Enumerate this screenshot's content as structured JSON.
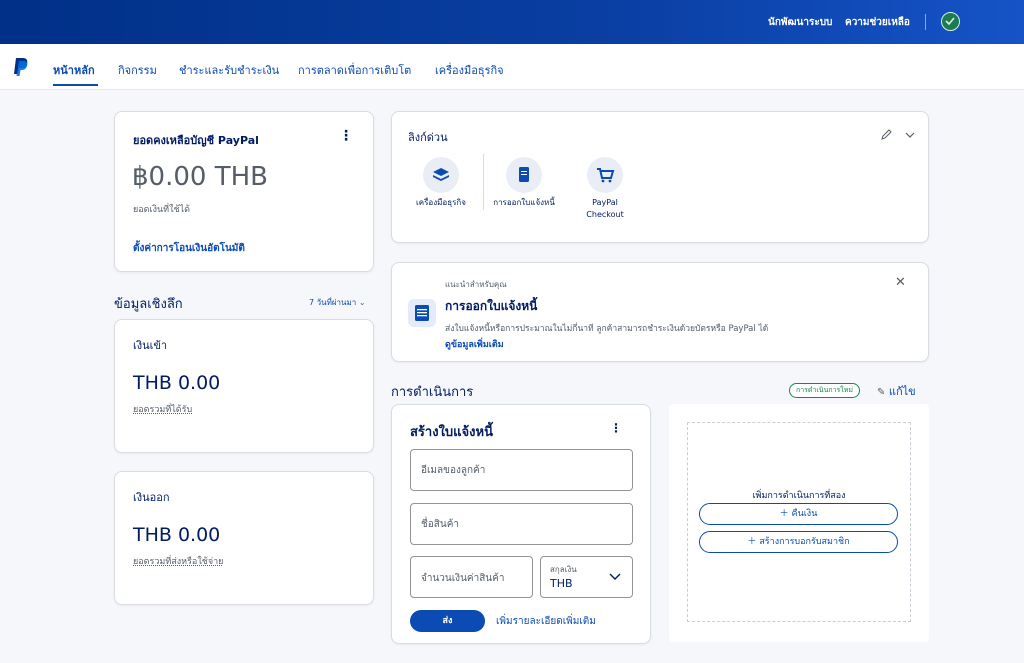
{
  "topbar": {
    "developer": "นักพัฒนาระบบ",
    "help": "ความช่วยเหลือ",
    "avatar_color": "#1e7a52"
  },
  "nav": {
    "tabs": [
      {
        "label": "หน้าหลัก",
        "active": true
      },
      {
        "label": "กิจกรรม"
      },
      {
        "label": "ชำระและรับชำระเงิน"
      },
      {
        "label": "การตลาดเพื่อการเติบโต"
      },
      {
        "label": "เครื่องมือธุรกิจ"
      }
    ]
  },
  "balance": {
    "title": "ยอดคงเหลือบัญชี PayPal",
    "amount": "฿0.00 THB",
    "subtitle": "ยอดเงินที่ใช้ได้",
    "auto_transfer": "ตั้งค่าการโอนเงินอัตโนมัติ"
  },
  "insights": {
    "title": "ข้อมูลเชิงลึก",
    "period": "7 วันที่ผ่านมา",
    "money_in": {
      "title": "เงินเข้า",
      "amount": "THB 0.00",
      "caption": "ยอดรวมที่ได้รับ"
    },
    "money_out": {
      "title": "เงินออก",
      "amount": "THB 0.00",
      "caption": "ยอดรวมที่ส่งหรือใช้จ่าย"
    }
  },
  "quick_links": {
    "title": "ลิงก์ด่วน",
    "items": [
      {
        "label": "เครื่องมือธุรกิจ",
        "icon": "layers-icon"
      },
      {
        "label": "การออกใบแจ้งหนี้",
        "icon": "document-icon"
      },
      {
        "label": "PayPal Checkout",
        "icon": "cart-icon"
      }
    ]
  },
  "recommend": {
    "eyebrow": "แนะนำสำหรับคุณ",
    "title": "การออกใบแจ้งหนี้",
    "body": "ส่งใบแจ้งหนี้หรือการประมาณในไม่กี่นาที ลูกค้าสามารถชำระเงินด้วยบัตรหรือ PayPal ได้",
    "link": "ดูข้อมูลเพิ่มเติม"
  },
  "actions": {
    "title": "การดำเนินการ",
    "new_badge": "การดำเนินการใหม่",
    "edit": "แก้ไข"
  },
  "invoice": {
    "title": "สร้างใบแจ้งหนี้",
    "email_placeholder": "อีเมลของลูกค้า",
    "product_placeholder": "ชื่อสินค้า",
    "amount_placeholder": "จำนวนเงินค่าสินค้า",
    "currency_label": "สกุลเงิน",
    "currency_value": "THB",
    "send": "ส่ง",
    "more_details": "เพิ่มรายละเอียดเพิ่มเติม"
  },
  "second_action": {
    "title": "เพิ่มการดำเนินการที่สอง",
    "refund": "คืนเงิน",
    "create_subscription": "สร้างการบอกรับสมาชิก"
  },
  "colors": {
    "primary": "#0b4bb3",
    "header": "#003087",
    "navy": "#001c64",
    "badge_green": "#128a4a"
  }
}
